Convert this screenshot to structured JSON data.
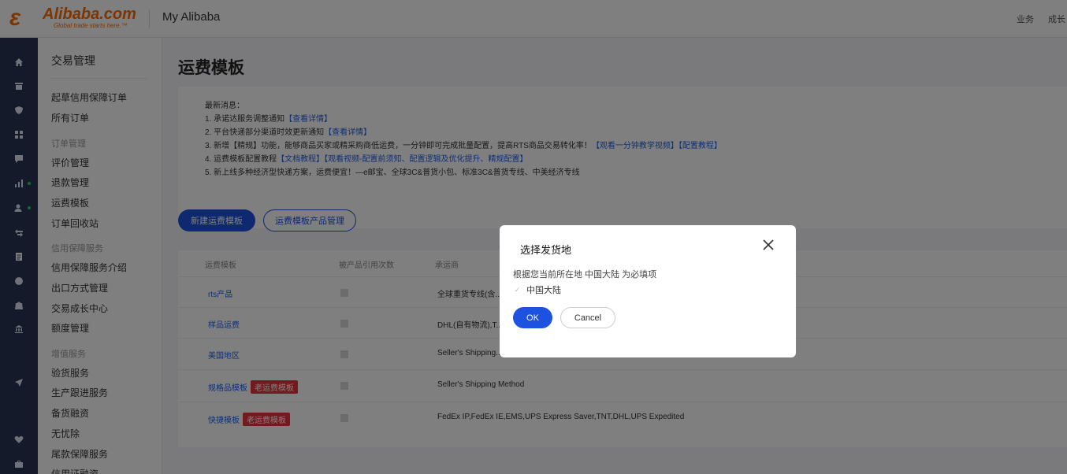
{
  "header": {
    "logo_text": "Alibaba.com",
    "logo_tagline": "Global trade starts here.™",
    "app_title": "My Alibaba",
    "links": [
      "业务",
      "成长"
    ]
  },
  "rail": {
    "icons": [
      "home-icon",
      "store-icon",
      "shield-icon",
      "grid-icon",
      "chat-icon",
      "chart-icon",
      "users-icon",
      "transfer-icon",
      "orders-icon",
      "globe-icon",
      "bag-icon",
      "bank-icon",
      "send-icon",
      "heart-icon",
      "briefcase-icon"
    ]
  },
  "sidebar": {
    "title": "交易管理",
    "items": [
      "起草信用保障订单",
      "所有订单"
    ],
    "group_order": "订单管理",
    "order_items": [
      "评价管理",
      "退款管理",
      "运费模板",
      "订单回收站"
    ],
    "group_credit": "信用保障服务",
    "credit_items": [
      "信用保障服务介绍",
      "出口方式管理",
      "交易成长中心",
      "额度管理"
    ],
    "group_value": "增值服务",
    "value_items": [
      "验货服务",
      "生产跟进服务",
      "备货融资",
      "无忧除",
      "尾款保障服务",
      "信用证融资"
    ]
  },
  "main": {
    "page_title": "运费模板",
    "notice": {
      "heading": "最新消息：",
      "lines": [
        {
          "text": "1. 承诺达服务调整通知",
          "link": "【查看详情】"
        },
        {
          "text": "2. 平台快递部分渠道时效更新通知",
          "link": "【查看详情】"
        },
        {
          "text": "3. 新增【精规】功能，能够商品买家或精采购商低运费，一分钟即可完成批量配置，提高RTS商品交易转化率！",
          "link": "【观看一分钟教学视频】【配置教程】"
        },
        {
          "text": "4. 运费模板配置教程",
          "link": "【文档教程】【观看视频-配置前须知、配置逻辑及优化提升、精规配置】"
        },
        {
          "text": "5. 新上线多种经济型快递方案，运费便宜！—e邮宝、全球3C&普货小包、标准3C&普货专线、中美经济专线",
          "link": ""
        }
      ]
    },
    "btn_new": "新建运费模板",
    "btn_manage": "运费模板产品管理",
    "table": {
      "headers": [
        "运费模板",
        "被产品引用次数",
        "承运商"
      ],
      "rows": [
        {
          "name": "rts产品",
          "tag": "",
          "carrier": "全球重货专线(含..."
        },
        {
          "name": "样品运费",
          "tag": "",
          "carrier": "DHL(自有物流),T..."
        },
        {
          "name": "美国地区",
          "tag": "",
          "carrier": "Seller's Shipping..."
        },
        {
          "name": "规格品模板",
          "tag": "老运费模板",
          "carrier": "Seller's Shipping Method"
        },
        {
          "name": "快捷模板",
          "tag": "老运费模板",
          "carrier": "FedEx IP,FedEx IE,EMS,UPS Express Saver,TNT,DHL,UPS Expedited"
        }
      ]
    }
  },
  "modal": {
    "title": "选择发货地",
    "description": "根据您当前所在地 中国大陆 为必填项",
    "checkbox_label": "中国大陆",
    "checkbox_checked": true,
    "ok_label": "OK",
    "cancel_label": "Cancel"
  },
  "colors": {
    "primary": "#1d52e0",
    "rail_bg": "#2a3554",
    "brand_orange": "#ff6a00",
    "tag_red": "#e8323c"
  }
}
